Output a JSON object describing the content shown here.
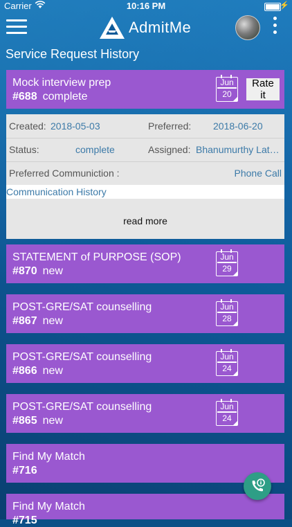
{
  "status_bar": {
    "carrier": "Carrier",
    "time": "10:16 PM"
  },
  "app": {
    "name": "AdmitMe"
  },
  "page": {
    "title": "Service Request History"
  },
  "details": {
    "created_label": "Created:",
    "created_value": "2018-05-03",
    "preferred_label": "Preferred:",
    "preferred_value": "2018-06-20",
    "status_label": "Status:",
    "status_value": "complete",
    "assigned_label": "Assigned:",
    "assigned_value": "Bhanumurthy Lat…",
    "comm_label": "Preferred Communiction :",
    "comm_value": "Phone Call",
    "comm_history": "Communication History",
    "read_more": "read more"
  },
  "requests": [
    {
      "title": "Mock interview prep",
      "number": "#688",
      "state": "complete",
      "month": "Jun",
      "day": "20",
      "action": "Rate it"
    },
    {
      "title": "STATEMENT of PURPOSE (SOP)",
      "number": "#870",
      "state": "new",
      "month": "Jun",
      "day": "29"
    },
    {
      "title": "POST-GRE/SAT counselling",
      "number": "#867",
      "state": "new",
      "month": "Jun",
      "day": "28"
    },
    {
      "title": "POST-GRE/SAT counselling",
      "number": "#866",
      "state": "new",
      "month": "Jun",
      "day": "24"
    },
    {
      "title": "POST-GRE/SAT counselling",
      "number": "#865",
      "state": "new",
      "month": "Jun",
      "day": "24"
    },
    {
      "title": "Find My Match",
      "number": "#716",
      "state": ""
    },
    {
      "title": "Find My Match",
      "number": "#715",
      "state": ""
    }
  ],
  "colors": {
    "card": "#9a58d0",
    "link": "#3c7aa8",
    "fab": "#2e9e86",
    "background": "#0b4f86"
  },
  "icons": {
    "menu": "hamburger-menu-icon",
    "more": "kebab-menu-icon",
    "calendar": "calendar-icon",
    "fab": "phone-info-icon"
  }
}
